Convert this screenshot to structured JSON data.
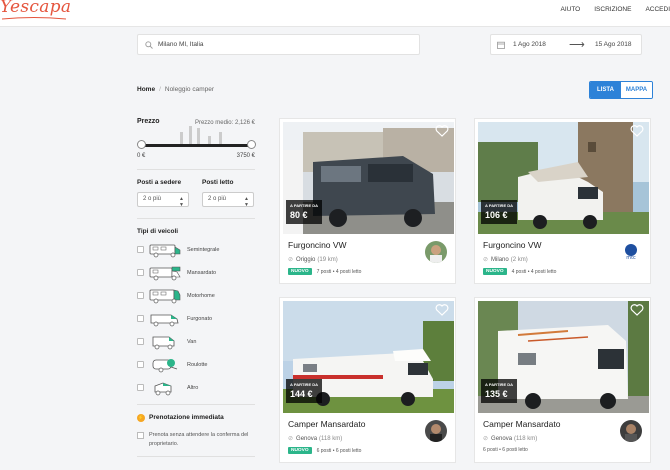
{
  "header": {
    "logo": "Yescapa",
    "nav": [
      "AIUTO",
      "ISCRIZIONE",
      "ACCEDI"
    ]
  },
  "search": {
    "location": "Milano MI, Italia",
    "date_from": "1 Ago 2018",
    "date_to": "15 Ago 2018"
  },
  "breadcrumb": {
    "home": "Home",
    "current": "Noleggio camper"
  },
  "view_toggle": {
    "list": "LISTA",
    "map": "MAPPA",
    "active": "list"
  },
  "filters": {
    "price": {
      "label": "Prezzo",
      "average": "Prezzo medio: 2,126 €",
      "min": "0 €",
      "max": "3750 €"
    },
    "seats": {
      "label": "Posti a sedere",
      "value": "2 o più"
    },
    "beds": {
      "label": "Posti letto",
      "value": "2 o più"
    },
    "types_label": "Tipi di veicoli",
    "types": [
      {
        "name": "Semintegrale",
        "icon": "semi-integrated-camper-icon"
      },
      {
        "name": "Mansardato",
        "icon": "overcab-camper-icon"
      },
      {
        "name": "Motorhome",
        "icon": "motorhome-icon"
      },
      {
        "name": "Furgonato",
        "icon": "van-conversion-icon"
      },
      {
        "name": "Van",
        "icon": "van-icon"
      },
      {
        "name": "Roulotte",
        "icon": "caravan-icon"
      },
      {
        "name": "Altro",
        "icon": "other-vehicle-icon"
      }
    ],
    "instant": {
      "label": "Prenotazione immediata",
      "description": "Prenota senza attendere la conferma del proprietario."
    }
  },
  "listings": [
    {
      "price_from": "A PARTIRE DA",
      "price": "80 €",
      "title": "Furgoncino VW",
      "location": "Origgio",
      "distance": "(19 km)",
      "is_new": true,
      "new_label": "NUOVO",
      "details": "7 posti • 4 posti letto"
    },
    {
      "price_from": "A PARTIRE DA",
      "price": "106 €",
      "title": "Furgoncino VW",
      "location": "Milano",
      "distance": "(2 km)",
      "is_new": true,
      "new_label": "NUOVO",
      "details": "4 posti • 4 posti letto"
    },
    {
      "price_from": "A PARTIRE DA",
      "price": "144 €",
      "title": "Camper Mansardato",
      "location": "Genova",
      "distance": "(118 km)",
      "is_new": true,
      "new_label": "NUOVO",
      "details": "6 posti • 6 posti letto"
    },
    {
      "price_from": "A PARTIRE DA",
      "price": "135 €",
      "title": "Camper Mansardato",
      "location": "Genova",
      "distance": "(118 km)",
      "is_new": false,
      "new_label": "",
      "details": "6 posti • 6 posti letto"
    }
  ],
  "colors": {
    "brand": "#e5553e",
    "primary": "#2d82d8",
    "new_badge": "#2bb58a",
    "instant": "#f5a623"
  }
}
